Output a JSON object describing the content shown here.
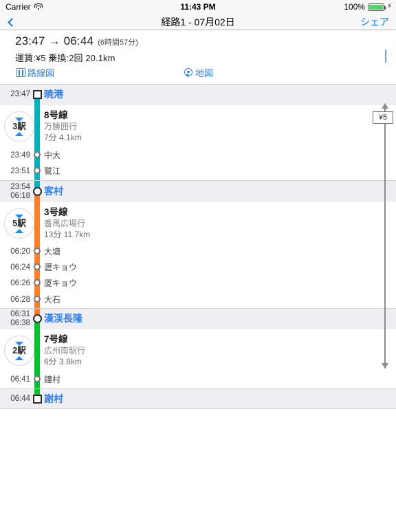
{
  "status_bar": {
    "carrier": "Carrier",
    "wifi_icon": "wifi-icon",
    "time": "11:43 PM",
    "battery_percent": "100%",
    "battery_icon": "battery-icon",
    "charging_icon": "lightning-bolt-icon"
  },
  "nav": {
    "back_icon": "chevron-left-icon",
    "title": "経路1 - 07月02日",
    "share_label": "シェア"
  },
  "summary": {
    "depart_time": "23:47",
    "arrow": "→",
    "arrive_time": "06:44",
    "times_combined": "23:47 → 06:44",
    "duration": "(6時間57分)",
    "details": "運賃:¥5  乗換:2回  20.1km",
    "disclosure_icon": "chevron-right-icon",
    "route_map_label": "路線図",
    "route_map_icon": "route-map-icon",
    "map_label": "地図",
    "map_icon": "map-pin-icon"
  },
  "fare_bracket": {
    "label": "¥5",
    "top_arrow_icon": "arrow-up-icon",
    "bottom_arrow_icon": "arrow-down-icon"
  },
  "colors": {
    "line_8": "#00b3be",
    "line_3": "#ff7f28",
    "line_7": "#00c32e",
    "accent": "#2d7ff0",
    "major_row_bg": "#eeeef3"
  },
  "itinerary": {
    "stops": [
      {
        "id": "s0",
        "kind": "terminal-start",
        "time": "23:47",
        "name": "暁港",
        "marker": "square-marker"
      },
      {
        "id": "s1",
        "kind": "intermediate",
        "time": "23:49",
        "name": "中大",
        "marker": "circle-marker"
      },
      {
        "id": "s2",
        "kind": "intermediate",
        "time": "23:51",
        "name": "鷺江",
        "marker": "circle-marker"
      },
      {
        "id": "s3",
        "kind": "transfer",
        "time": "23:54",
        "time2": "06:18",
        "name": "客村",
        "marker": "circle-marker-large"
      },
      {
        "id": "s4",
        "kind": "intermediate",
        "time": "06:20",
        "name": "大塘",
        "marker": "circle-marker"
      },
      {
        "id": "s5",
        "kind": "intermediate",
        "time": "06:24",
        "name": "瀝キョウ",
        "marker": "circle-marker"
      },
      {
        "id": "s6",
        "kind": "intermediate",
        "time": "06:26",
        "name": "厦キョウ",
        "marker": "circle-marker"
      },
      {
        "id": "s7",
        "kind": "intermediate",
        "time": "06:28",
        "name": "大石",
        "marker": "circle-marker"
      },
      {
        "id": "s8",
        "kind": "transfer",
        "time": "06:31",
        "time2": "06:38",
        "name": "漢渓長隆",
        "marker": "circle-marker-large"
      },
      {
        "id": "s9",
        "kind": "intermediate",
        "time": "06:41",
        "name": "鐘村",
        "marker": "circle-marker"
      },
      {
        "id": "s10",
        "kind": "terminal-end",
        "time": "06:44",
        "name": "謝村",
        "marker": "square-marker"
      }
    ],
    "legs": [
      {
        "id": "leg0",
        "stop_count": "3駅",
        "line_name": "8号線",
        "destination": "万勝囲行",
        "meta": "7分  4.1km",
        "expand_icon": "triangle-down-icon",
        "collapse_icon": "triangle-up-icon"
      },
      {
        "id": "leg1",
        "stop_count": "5駅",
        "line_name": "3号線",
        "destination": "番禺広場行",
        "meta": "13分  11.7km",
        "expand_icon": "triangle-down-icon",
        "collapse_icon": "triangle-up-icon"
      },
      {
        "id": "leg2",
        "stop_count": "2駅",
        "line_name": "7号線",
        "destination": "広州南駅行",
        "meta": "6分  3.8km",
        "expand_icon": "triangle-down-icon",
        "collapse_icon": "triangle-up-icon"
      }
    ]
  }
}
